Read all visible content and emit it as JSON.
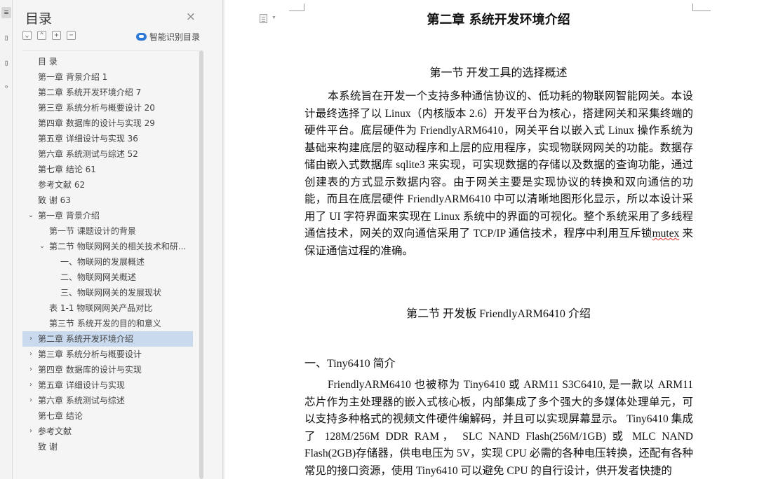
{
  "sidebar_panel": {
    "title": "目录",
    "close_glyph": "×",
    "tools": [
      "⌄",
      "⌃",
      "+",
      "−"
    ],
    "smart_toc_label": "智能识别目录",
    "icons": {
      "cloud": "cloud-ai-icon",
      "close": "close-icon"
    }
  },
  "toc_items": [
    {
      "text": "目    录",
      "level": 0,
      "arrow": ""
    },
    {
      "text": "第一章   背景介绍  1",
      "level": 0,
      "arrow": ""
    },
    {
      "text": "第二章   系统开发环境介绍 7",
      "level": 0,
      "arrow": ""
    },
    {
      "text": "第三章   系统分析与概要设计  20",
      "level": 0,
      "arrow": ""
    },
    {
      "text": "第四章   数据库的设计与实现 29",
      "level": 0,
      "arrow": ""
    },
    {
      "text": "第五章   详细设计与实现  36",
      "level": 0,
      "arrow": ""
    },
    {
      "text": "第六章   系统测试与综述  52",
      "level": 0,
      "arrow": ""
    },
    {
      "text": "第七章   结论  61",
      "level": 0,
      "arrow": ""
    },
    {
      "text": "参考文献  62",
      "level": 0,
      "arrow": ""
    },
    {
      "text": "致      谢 63",
      "level": 0,
      "arrow": ""
    },
    {
      "text": "第一章  背景介绍",
      "level": 0,
      "arrow": "⌄"
    },
    {
      "text": "第一节  课题设计的背景",
      "level": 1,
      "arrow": ""
    },
    {
      "text": "第二节  物联网网关的相关技术和研...",
      "level": 1,
      "arrow": "⌄"
    },
    {
      "text": "一、物联网的发展概述",
      "level": 2,
      "arrow": ""
    },
    {
      "text": "二、物联网网关概述",
      "level": 2,
      "arrow": ""
    },
    {
      "text": "三、物联网网关的发展现状",
      "level": 2,
      "arrow": ""
    },
    {
      "text": "表 1-1 物联网网关产品对比",
      "level": 1,
      "arrow": ""
    },
    {
      "text": "第三节  系统开发的目的和意义",
      "level": 1,
      "arrow": ""
    },
    {
      "text": "第二章  系统开发环境介绍",
      "level": 0,
      "arrow": "›",
      "selected": true
    },
    {
      "text": "第三章  系统分析与概要设计",
      "level": 0,
      "arrow": "›"
    },
    {
      "text": "第四章  数据库的设计与实现",
      "level": 0,
      "arrow": "›"
    },
    {
      "text": "第五章  详细设计与实现",
      "level": 0,
      "arrow": "›"
    },
    {
      "text": "第六章  系统测试与综述",
      "level": 0,
      "arrow": "›"
    },
    {
      "text": "第七章  结论",
      "level": 0,
      "arrow": ""
    },
    {
      "text": "参考文献",
      "level": 0,
      "arrow": "›"
    },
    {
      "text": "致      谢",
      "level": 0,
      "arrow": ""
    }
  ],
  "document": {
    "chapter_title": "第二章  系统开发环境介绍",
    "section1_title": "第一节  开发工具的选择概述",
    "section1_body_before": "本系统旨在开发一个支持多种通信协议的、低功耗的物联网智能网关。本设计最终选择了以 Linux（内核版本 2.6）开发平台为核心，搭建网关和采集终端的硬件平台。底层硬件为 FriendlyARM6410，网关平台以嵌入式 Linux 操作系统为基础来构建底层的驱动程序和上层的应用程序，实现物联网网关的功能。数据存储由嵌入式数据库 sqlite3 来实现，可实现数据的存储以及数据的查询功能，通过创建表的方式显示数据内容。由于网关主要是实现协议的转换和双向通信的功能，而且在底层硬件 FriendlyARM6410 中可以清晰地图形化显示，所以本设计采用了 UI 字符界面来实现在 Linux 系统中的界面的可视化。整个系统采用了多线程通信技术，网关的双向通信采用了 TCP/IP 通信技术，程序中利用互斥锁",
    "section1_body_squiggle": "mutex",
    "section1_body_after": " 来保证通信过程的准确。",
    "section2_title": "第二节  开发板 FriendlyARM6410 介绍",
    "subsection_title": "一、Tiny6410 简介",
    "section2_body": "FriendlyARM6410 也被称为 Tiny6410 或 ARM11 S3C6410, 是一款以 ARM11 芯片作为主处理器的嵌入式核心板，内部集成了多个强大的多媒体处理单元，可以支持多种格式的视频文件硬件编解码，并且可以实现屏幕显示。 Tiny6410 集成了 128M/256M DDR RAM， SLC NAND Flash(256M/1GB) 或   MLC NAND Flash(2GB)存储器，供电电压为 5V，实现 CPU 必需的各种电压转换，还配有各种常见的接口资源，使用 Tiny6410 可以避免 CPU 的自行设计，供开发者快捷的"
  }
}
